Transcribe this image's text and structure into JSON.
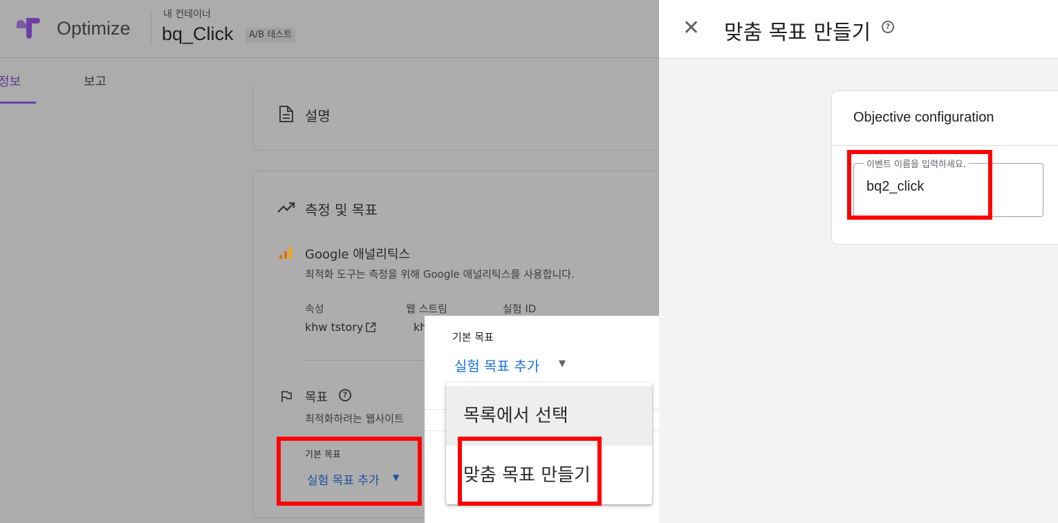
{
  "header": {
    "app_title": "Optimize",
    "container_label": "내 컨테이너",
    "experiment_name": "bq_Click",
    "experiment_type": "A/B 테스트"
  },
  "tabs": [
    {
      "label": "세부정보",
      "active": true
    },
    {
      "label": "보고",
      "active": false
    }
  ],
  "description_card": {
    "title": "설명"
  },
  "measurement": {
    "title": "측정 및 목표",
    "ga_title": "Google 애널리틱스",
    "ga_desc": "최적화 도구는 측정을 위해 Google 애널리틱스를 사용합니다.",
    "columns": [
      {
        "header": "속성",
        "value": "khw tstory"
      },
      {
        "header": "웹 스트림",
        "value": "kh"
      },
      {
        "header": "실험 ID",
        "value": ""
      }
    ],
    "goals_title": "목표",
    "goals_desc": "최적화하려는 웹사이트",
    "primary_goal_label": "기본 목표",
    "add_goal_link": "실험 목표 추가"
  },
  "dropdown": {
    "section_label": "기본 목표",
    "add_goal_link": "실험 목표 추가",
    "menu_items": [
      "목록에서 선택",
      "맞춤 목표 만들기"
    ]
  },
  "side_panel": {
    "title": "맞춤 목표 만들기",
    "close_glyph": "✕",
    "help_glyph": "?",
    "card_title": "Objective configuration",
    "field_label": "이벤트 이름을 입력하세요.",
    "field_value": "bq2_click"
  },
  "colors": {
    "highlight": "#ff0000",
    "link_blue": "#1a73e8",
    "brand_purple": "#7b3fb9"
  }
}
